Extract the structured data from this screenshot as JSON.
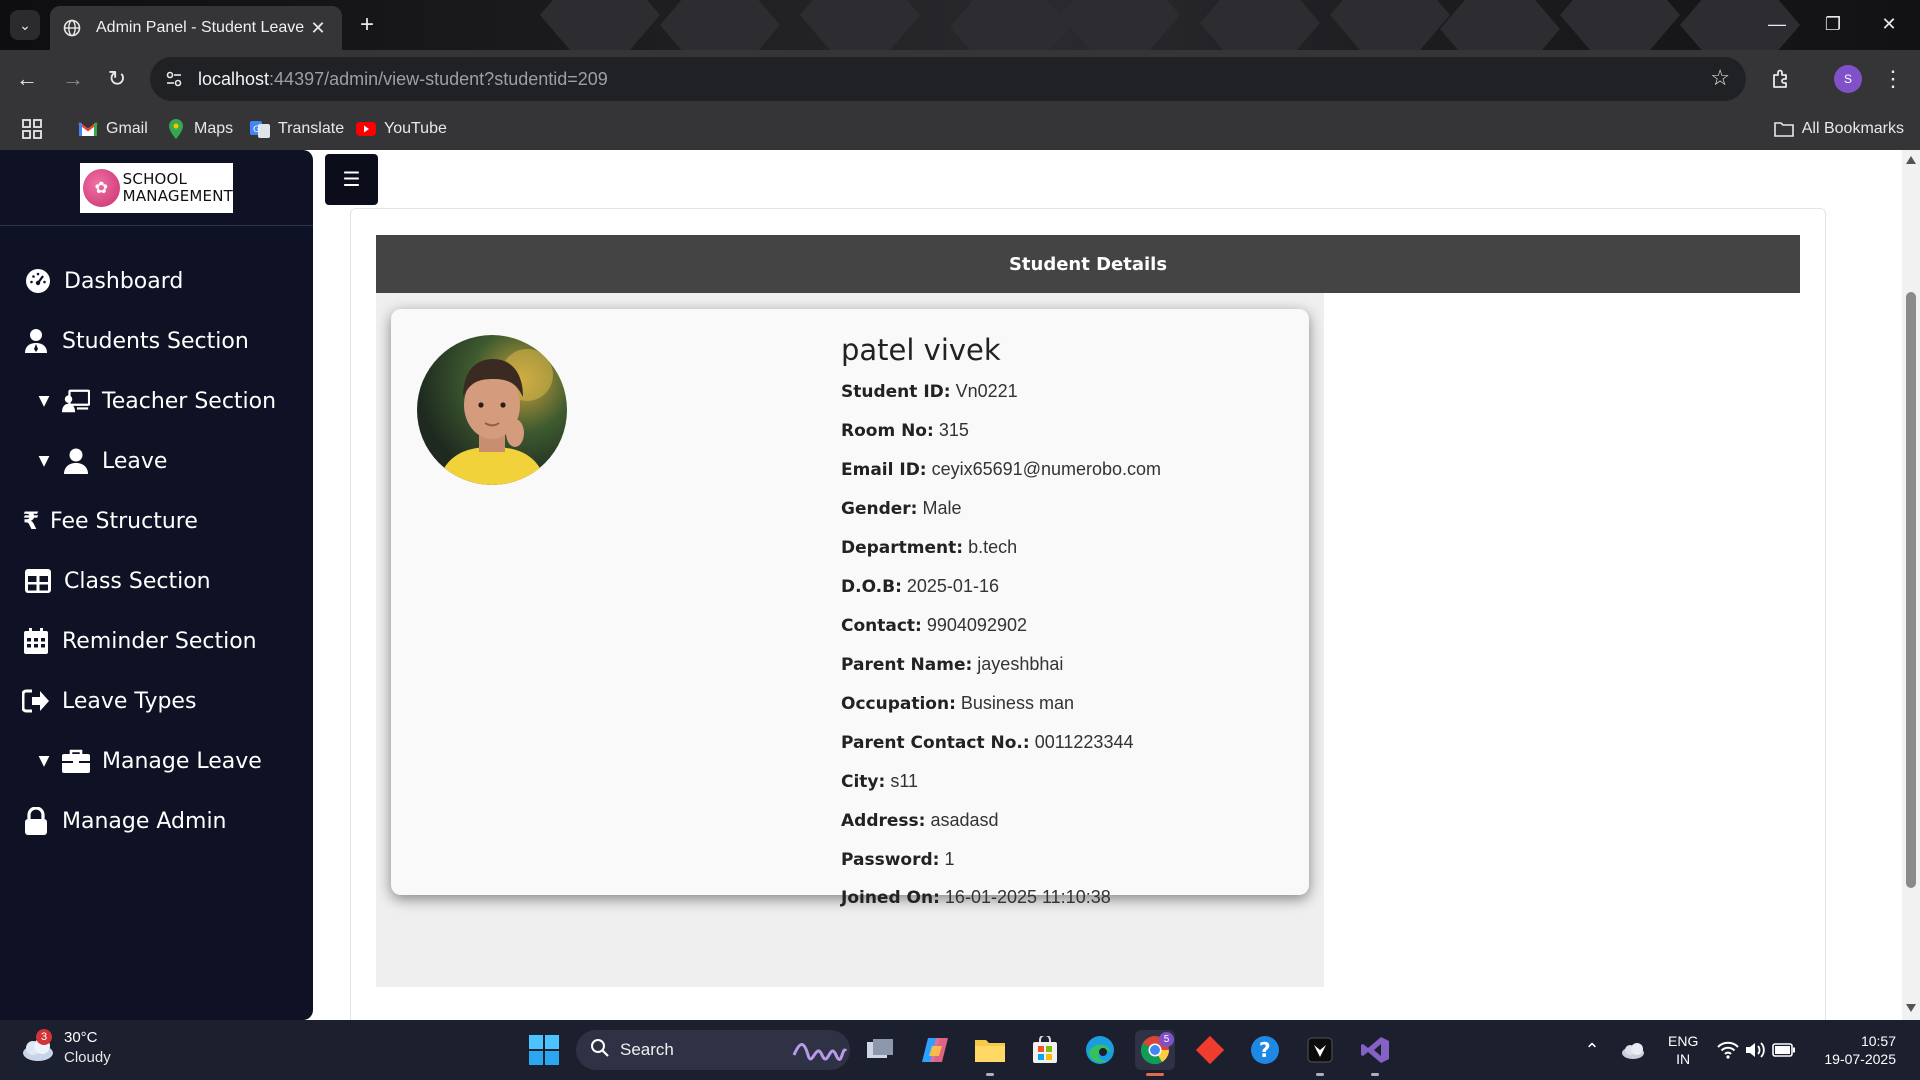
{
  "browser": {
    "tab_title": "Admin Panel - Student Leave",
    "url_host": "localhost",
    "url_rest": ":44397/admin/view-student?studentid=209",
    "bookmarks": [
      "Gmail",
      "Maps",
      "Translate",
      "YouTube"
    ],
    "all_bookmarks": "All Bookmarks",
    "profile_initial": "S"
  },
  "sidebar": {
    "logo_line1": "SCHOOL",
    "logo_line2": "MANAGEMENT",
    "items": [
      {
        "label": "Dashboard",
        "icon": "dashboard-icon"
      },
      {
        "label": "Students Section",
        "icon": "user-icon"
      },
      {
        "label": "Teacher Section",
        "icon": "teacher-icon",
        "caret": true
      },
      {
        "label": "Leave",
        "icon": "user-icon",
        "caret": true
      },
      {
        "label": "Fee Structure",
        "icon": "rupee-icon"
      },
      {
        "label": "Class Section",
        "icon": "table-icon"
      },
      {
        "label": "Reminder Section",
        "icon": "calendar-icon"
      },
      {
        "label": "Leave Types",
        "icon": "sign-out-icon"
      },
      {
        "label": "Manage Leave",
        "icon": "briefcase-icon",
        "caret": true
      },
      {
        "label": "Manage Admin",
        "icon": "lock-icon"
      }
    ]
  },
  "main": {
    "header": "Student Details",
    "student_name": "patel vivek",
    "fields": [
      {
        "label": "Student ID:",
        "value": "Vn0221"
      },
      {
        "label": "Room No:",
        "value": "315"
      },
      {
        "label": "Email ID:",
        "value": "ceyix65691@numerobo.com"
      },
      {
        "label": "Gender:",
        "value": "Male"
      },
      {
        "label": "Department:",
        "value": "b.tech"
      },
      {
        "label": "D.O.B:",
        "value": "2025-01-16"
      },
      {
        "label": "Contact:",
        "value": "9904092902"
      },
      {
        "label": "Parent Name:",
        "value": "jayeshbhai"
      },
      {
        "label": "Occupation:",
        "value": "Business man"
      },
      {
        "label": "Parent Contact No.:",
        "value": "0011223344"
      },
      {
        "label": "City:",
        "value": "s11"
      },
      {
        "label": "Address:",
        "value": "asadasd"
      },
      {
        "label": "Password:",
        "value": "1"
      },
      {
        "label": "Joined On:",
        "value": "16-01-2025 11:10:38"
      }
    ]
  },
  "taskbar": {
    "weather_badge": "3",
    "temperature": "30°C",
    "condition": "Cloudy",
    "search_label": "Search",
    "chrome_badge": "5",
    "lang_line1": "ENG",
    "lang_line2": "IN",
    "time": "10:57",
    "date": "19-07-2025"
  },
  "colors": {
    "sidebar_bg": "#0e1224",
    "header_bg": "#444444",
    "card_bg": "#f9f9f9"
  }
}
